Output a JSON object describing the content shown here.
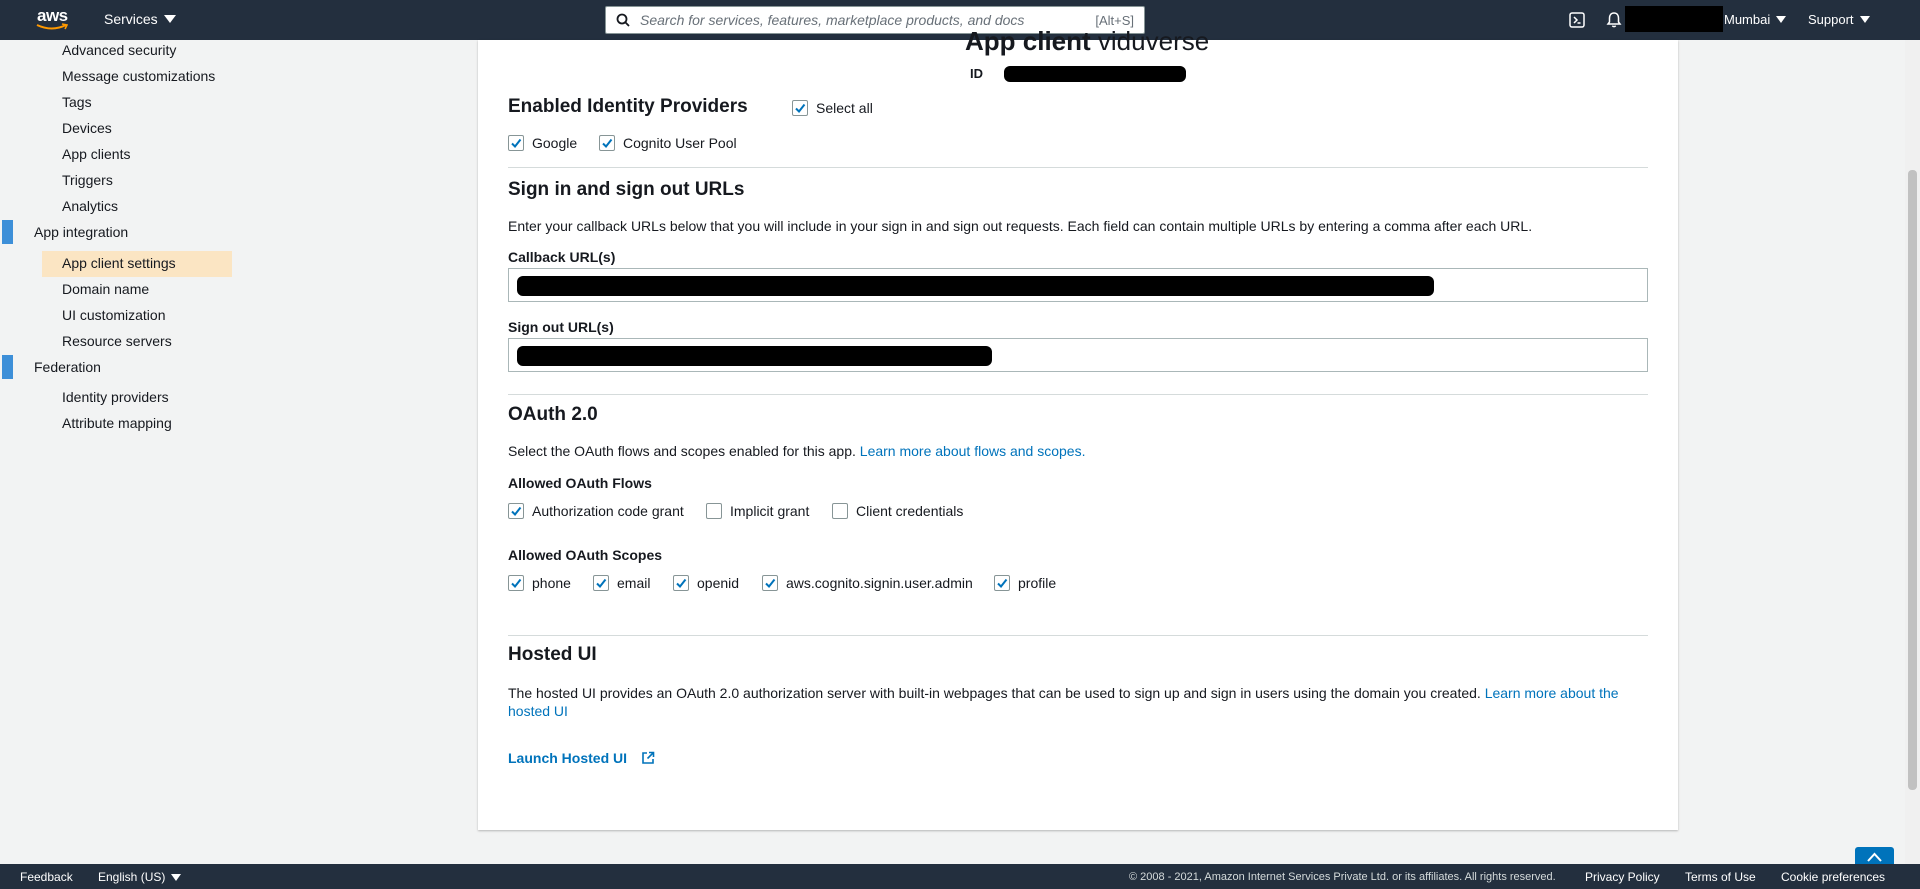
{
  "topnav": {
    "logo_text": "aws",
    "services_label": "Services",
    "search_placeholder": "Search for services, features, marketplace products, and docs",
    "search_shortcut": "[Alt+S]",
    "region_label": "Mumbai",
    "support_label": "Support"
  },
  "sidebar": {
    "items_top": [
      "Advanced security",
      "Message customizations",
      "Tags",
      "Devices",
      "App clients",
      "Triggers",
      "Analytics"
    ],
    "section_app_integration": "App integration",
    "items_app_integration": [
      "App client settings",
      "Domain name",
      "UI customization",
      "Resource servers"
    ],
    "section_federation": "Federation",
    "items_federation": [
      "Identity providers",
      "Attribute mapping"
    ],
    "accent_color": "#3d8fd8",
    "active_bg": "#fbe5c3"
  },
  "main": {
    "title_bold": "App client",
    "title_rest": "viduverse",
    "id_label": "ID",
    "identity_providers": {
      "heading": "Enabled Identity Providers",
      "select_all": "Select all",
      "providers": [
        "Google",
        "Cognito User Pool"
      ]
    },
    "urls": {
      "heading": "Sign in and sign out URLs",
      "description": "Enter your callback URLs below that you will include in your sign in and sign out requests. Each field can contain multiple URLs by entering a comma after each URL.",
      "callback_label": "Callback URL(s)",
      "signout_label": "Sign out URL(s)"
    },
    "oauth": {
      "heading": "OAuth 2.0",
      "description": "Select the OAuth flows and scopes enabled for this app.",
      "learn_more": "Learn more about flows and scopes.",
      "flows_label": "Allowed OAuth Flows",
      "flows": [
        {
          "label": "Authorization code grant",
          "checked": true
        },
        {
          "label": "Implicit grant",
          "checked": false
        },
        {
          "label": "Client credentials",
          "checked": false
        }
      ],
      "scopes_label": "Allowed OAuth Scopes",
      "scopes": [
        "phone",
        "email",
        "openid",
        "aws.cognito.signin.user.admin",
        "profile"
      ]
    },
    "hosted_ui": {
      "heading": "Hosted UI",
      "description": "The hosted UI provides an OAuth 2.0 authorization server with built-in webpages that can be used to sign up and sign in users using the domain you created.",
      "learn_more": "Learn more about the hosted UI",
      "launch": "Launch Hosted UI"
    }
  },
  "footer": {
    "feedback": "Feedback",
    "language": "English (US)",
    "copyright": "© 2008 - 2021, Amazon Internet Services Private Ltd. or its affiliates. All rights reserved.",
    "privacy": "Privacy Policy",
    "terms": "Terms of Use",
    "cookies": "Cookie preferences"
  },
  "colors": {
    "nav_bg": "#232f3e",
    "link": "#0073bb",
    "checkbox_check": "#0073bb"
  }
}
